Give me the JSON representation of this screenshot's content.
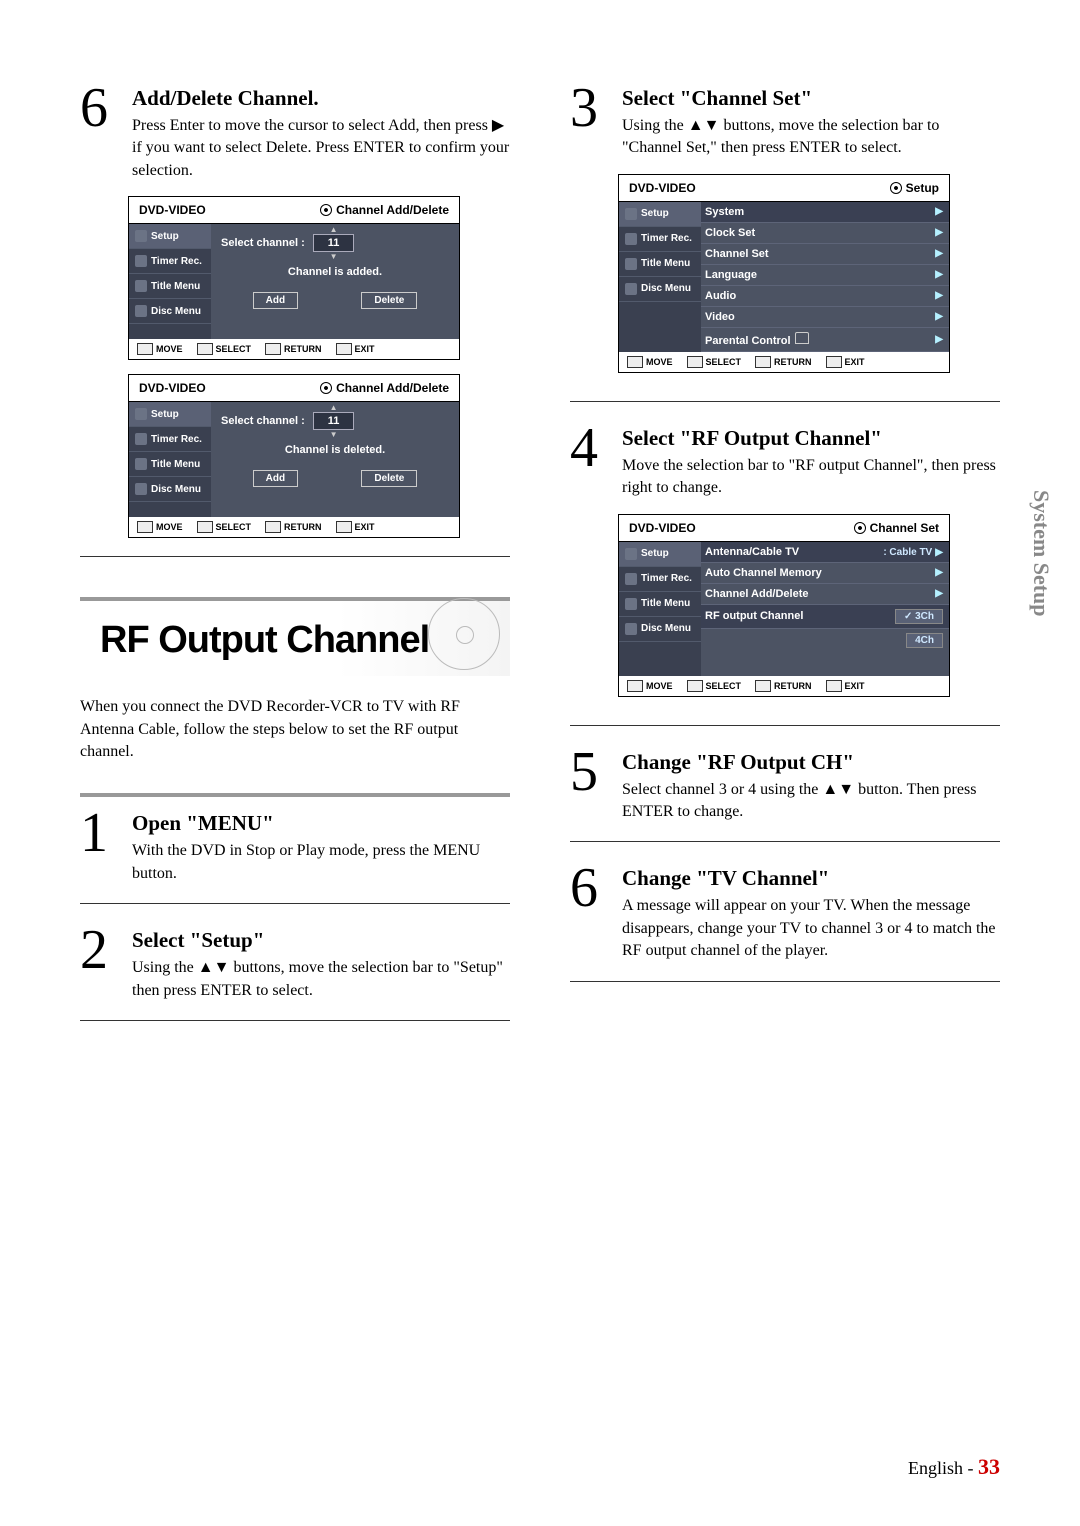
{
  "sideTab": "System Setup",
  "footer": {
    "lang": "English - ",
    "page": "33"
  },
  "left": {
    "step6a": {
      "num": "6",
      "title": "Add/Delete Channel.",
      "desc": "Press Enter to move the cursor to select Add, then press ▶ if you want to select Delete. Press ENTER to confirm your selection."
    },
    "rf": {
      "title": "RF Output Channel",
      "intro": "When you connect the DVD Recorder-VCR to TV with RF Antenna Cable, follow the steps below to set the RF output channel."
    },
    "step1": {
      "num": "1",
      "title": "Open \"MENU\"",
      "desc": "With the DVD in Stop or Play mode, press the MENU button."
    },
    "step2": {
      "num": "2",
      "title": "Select \"Setup\"",
      "desc": "Using the ▲▼ buttons, move the selection bar to \"Setup\" then press ENTER to select."
    }
  },
  "right": {
    "step3": {
      "num": "3",
      "title": "Select \"Channel Set\"",
      "desc": "Using the ▲▼ buttons, move the selection bar to \"Channel Set,\" then press ENTER to select."
    },
    "step4": {
      "num": "4",
      "title": "Select \"RF Output Channel\"",
      "desc": "Move the selection bar to \"RF output Channel\", then press right to change."
    },
    "step5": {
      "num": "5",
      "title": "Change \"RF Output CH\"",
      "desc": "Select channel 3 or 4 using the ▲▼ button. Then press ENTER to change."
    },
    "step6b": {
      "num": "6",
      "title": "Change \"TV Channel\"",
      "desc": "A message will appear on your TV. When the message disappears, change your TV to channel 3 or 4 to match the RF output channel of the player."
    }
  },
  "osd": {
    "dvdvideo": "DVD-VIDEO",
    "nav": [
      "Setup",
      "Timer Rec.",
      "Title Menu",
      "Disc Menu"
    ],
    "footer": {
      "move": "MOVE",
      "select": "SELECT",
      "return": "RETURN",
      "exit": "EXIT"
    },
    "addDelete": {
      "header": "Channel Add/Delete",
      "selectChannel": "Select channel :",
      "channelNum": "11",
      "addedMsg": "Channel is added.",
      "deletedMsg": "Channel is deleted.",
      "add": "Add",
      "delete": "Delete"
    },
    "setup": {
      "header": "Setup",
      "items": [
        "System",
        "Clock Set",
        "Channel Set",
        "Language",
        "Audio",
        "Video",
        "Parental Control"
      ]
    },
    "channelSet": {
      "header": "Channel Set",
      "antenna": "Antenna/Cable TV",
      "antennaVal": ": Cable TV",
      "auto": "Auto Channel Memory",
      "addDel": "Channel Add/Delete",
      "rfOut": "RF output Channel",
      "v3": "✓ 3Ch",
      "v4": "4Ch"
    }
  }
}
